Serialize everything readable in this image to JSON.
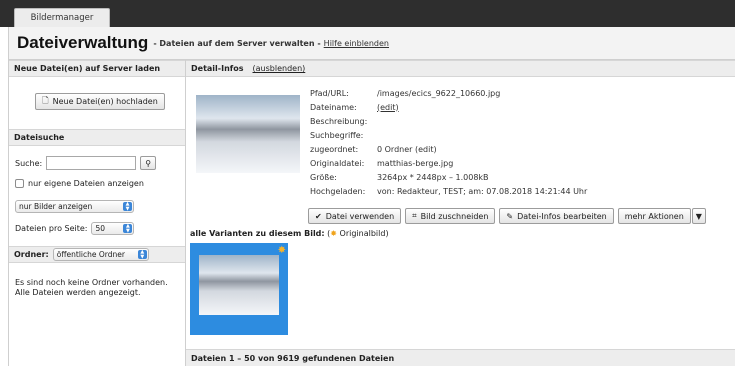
{
  "tabs": {
    "active": "Bildermanager"
  },
  "header": {
    "title": "Dateiverwaltung",
    "subtitle": "- Dateien auf dem Server verwalten -",
    "help_link": "Hilfe einblenden"
  },
  "upload": {
    "heading": "Neue Datei(en) auf Server laden",
    "button_label": "Neue Datei(en) hochladen"
  },
  "search": {
    "heading": "Dateisuche",
    "label": "Suche:",
    "value": "",
    "own_files_label": "nur eigene Dateien anzeigen",
    "type_filter": "nur Bilder anzeigen",
    "per_page_label": "Dateien pro Seite:",
    "per_page_value": "50"
  },
  "folder": {
    "label": "Ordner:",
    "value": "öffentliche Ordner",
    "note": "Es sind noch keine Ordner vorhanden. Alle Dateien werden angezeigt."
  },
  "detail": {
    "heading": "Detail-Infos",
    "toggle": "(ausblenden)",
    "rows": [
      {
        "key": "Pfad/URL:",
        "value": "/images/ecics_9622_10660.jpg"
      },
      {
        "key": "Dateiname:",
        "value": "(edit)"
      },
      {
        "key": "Beschreibung:",
        "value": ""
      },
      {
        "key": "Suchbegriffe:",
        "value": ""
      },
      {
        "key": "zugeordnet:",
        "value": "0 Ordner (edit)"
      },
      {
        "key": "Originaldatei:",
        "value": "matthias-berge.jpg"
      },
      {
        "key": "Größe:",
        "value": "3264px * 2448px – 1.008kB"
      },
      {
        "key": "Hochgeladen:",
        "value": "von: Redakteur, TEST; am: 07.08.2018 14:21:44 Uhr"
      }
    ],
    "actions": {
      "use": "Datei verwenden",
      "crop": "Bild zuschneiden",
      "edit": "Datei-Infos bearbeiten",
      "more": "mehr Aktionen"
    }
  },
  "variants": {
    "label": "alle Varianten zu diesem Bild:",
    "legend_open": "(",
    "legend_text": "Originalbild)"
  },
  "results": {
    "text": "Dateien 1 – 50 von 9619 gefundenen Dateien"
  },
  "icons": {
    "upload": "file-icon",
    "search": "magnifier-icon",
    "use": "check-icon",
    "crop": "crop-icon",
    "edit": "pencil-icon",
    "more": "caret-down-icon",
    "star": "star-icon"
  },
  "colors": {
    "accent": "#2d8ce0",
    "star": "#f0a41c",
    "topbar": "#2e2e2e"
  }
}
